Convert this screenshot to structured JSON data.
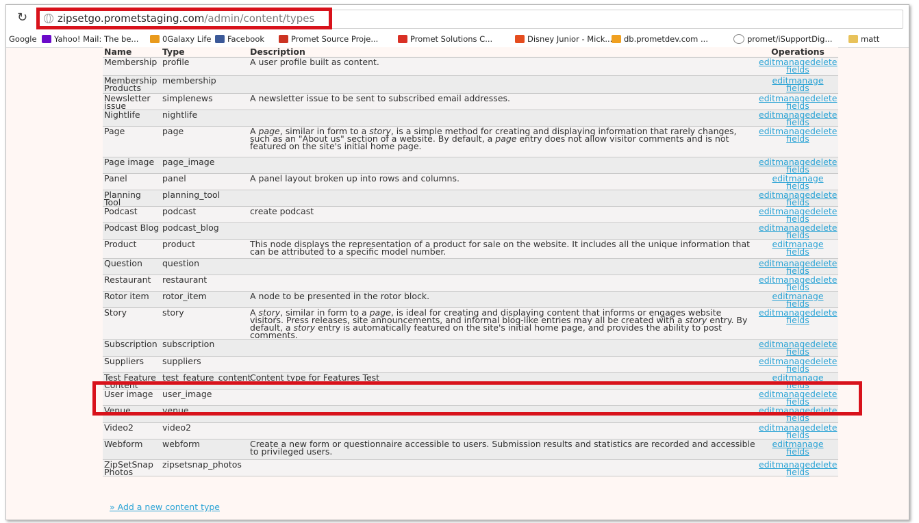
{
  "browser": {
    "url_host": "zipsetgo.prometstaging.com",
    "url_path": "/admin/content/types",
    "bookmarks": [
      {
        "label": "Google",
        "icon": "google-text",
        "color": "#000000"
      },
      {
        "label": "Yahoo! Mail: The be...",
        "icon": "yahoo-icon",
        "color": "#6b0ac9"
      },
      {
        "label": "0Galaxy Life",
        "icon": "galaxy-life-icon",
        "color": "#e99a1c"
      },
      {
        "label": "Facebook",
        "icon": "facebook-icon",
        "color": "#3b5998"
      },
      {
        "label": "Promet Source Proje...",
        "icon": "promet-source-icon",
        "color": "#cc3322"
      },
      {
        "label": "Promet Solutions C...",
        "icon": "gmail-icon",
        "color": "#d93025"
      },
      {
        "label": "Disney Junior - Mick...",
        "icon": "disney-junior-icon",
        "color": "#e54c1e"
      },
      {
        "label": "db.prometdev.com ...",
        "icon": "phpmyadmin-icon",
        "color": "#f0a020"
      },
      {
        "label": "promet/iSupportDig...",
        "icon": "github-icon",
        "color": "#888888"
      },
      {
        "label": "matt",
        "icon": "folder-icon",
        "color": "#e8c25a"
      }
    ]
  },
  "table": {
    "headers": {
      "name": "Name",
      "type": "Type",
      "description": "Description",
      "operations": "Operations"
    },
    "op_labels": {
      "edit": "edit",
      "manage": "manage",
      "fields": "fields",
      "delete": "delete"
    },
    "rows": [
      {
        "name": "Membership",
        "type": "profile",
        "description": "A user profile built as content.",
        "has_delete": true
      },
      {
        "name": "Membership Products",
        "type": "membership",
        "description": "",
        "has_delete": false
      },
      {
        "name": "Newsletter issue",
        "type": "simplenews",
        "description": "A newsletter issue to be sent to subscribed email addresses.",
        "has_delete": true
      },
      {
        "name": "Nightlife",
        "type": "nightlife",
        "description": "",
        "has_delete": true
      },
      {
        "name": "Page",
        "type": "page",
        "description_parts": [
          "A ",
          "page",
          ", similar in form to a ",
          "story",
          ", is a simple method for creating and displaying information that rarely changes, such as an \"About us\" section of a website. By default, a ",
          "page",
          " entry does not allow visitor comments and is not featured on the site's initial home page."
        ],
        "has_delete": true
      },
      {
        "name": "Page image",
        "type": "page_image",
        "description": "",
        "has_delete": true
      },
      {
        "name": "Panel",
        "type": "panel",
        "description": "A panel layout broken up into rows and columns.",
        "has_delete": false
      },
      {
        "name": "Planning Tool",
        "type": "planning_tool",
        "description": "",
        "has_delete": true
      },
      {
        "name": "Podcast",
        "type": "podcast",
        "description": "create podcast",
        "has_delete": true
      },
      {
        "name": "Podcast Blog",
        "type": "podcast_blog",
        "description": "",
        "has_delete": true
      },
      {
        "name": "Product",
        "type": "product",
        "description": "This node displays the representation of a product for sale on the website. It includes all the unique information that can be attributed to a specific model number.",
        "has_delete": false
      },
      {
        "name": "Question",
        "type": "question",
        "description": "",
        "has_delete": true
      },
      {
        "name": "Restaurant",
        "type": "restaurant",
        "description": "",
        "has_delete": true
      },
      {
        "name": "Rotor item",
        "type": "rotor_item",
        "description": "A node to be presented in the rotor block.",
        "has_delete": false
      },
      {
        "name": "Story",
        "type": "story",
        "description_parts": [
          "A ",
          "story",
          ", similar in form to a ",
          "page",
          ", is ideal for creating and displaying content that informs or engages website visitors. Press releases, site announcements, and informal blog-like entries may all be created with a ",
          "story",
          " entry. By default, a ",
          "story",
          " entry is automatically featured on the site's initial home page, and provides the ability to post comments."
        ],
        "has_delete": true
      },
      {
        "name": "Subscription",
        "type": "subscription",
        "description": "",
        "has_delete": true
      },
      {
        "name": "Suppliers",
        "type": "suppliers",
        "description": "",
        "has_delete": true
      },
      {
        "name": "Test Feature Content",
        "type": "test_feature_content",
        "description": "Content type for Features Test",
        "has_delete": false
      },
      {
        "name": "User image",
        "type": "user_image",
        "description": "",
        "has_delete": true
      },
      {
        "name": "Venue",
        "type": "venue",
        "description": "",
        "has_delete": true
      },
      {
        "name": "Video2",
        "type": "video2",
        "description": "",
        "has_delete": true
      },
      {
        "name": "Webform",
        "type": "webform",
        "description": "Create a new form or questionnaire accessible to users. Submission results and statistics are recorded and accessible to privileged users.",
        "has_delete": false
      },
      {
        "name": "ZipSetSnap Photos",
        "type": "zipsetsnap_photos",
        "description": "",
        "has_delete": true
      }
    ],
    "add_link": "» Add a new content type"
  },
  "highlight_color": "#d8121b"
}
